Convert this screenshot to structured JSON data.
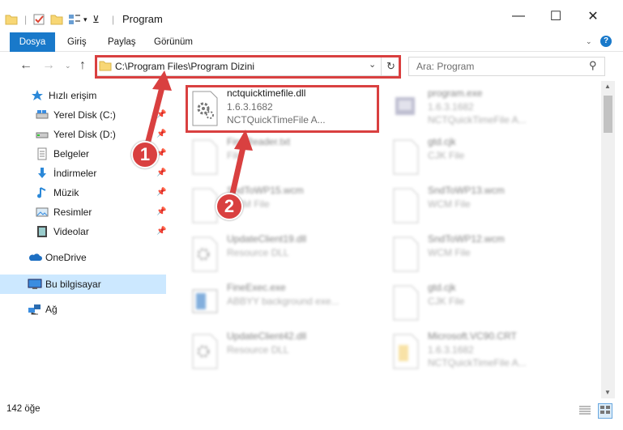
{
  "window": {
    "title": "Program",
    "minimize": "—",
    "maximize": "☐",
    "close": "✕"
  },
  "ribbon": {
    "tabs": [
      "Dosya",
      "Giriş",
      "Paylaş",
      "Görünüm"
    ],
    "help": "?"
  },
  "address": {
    "path": "C:\\Program Files\\Program Dizini"
  },
  "search": {
    "placeholder": "Ara: Program"
  },
  "sidebar": {
    "items": [
      {
        "label": "Hızlı erişim",
        "icon": "star-icon",
        "pinned": false
      },
      {
        "label": "Yerel Disk (C:)",
        "icon": "drive-icon",
        "pinned": true
      },
      {
        "label": "Yerel Disk (D:)",
        "icon": "drive-icon",
        "pinned": true
      },
      {
        "label": "Belgeler",
        "icon": "document-icon",
        "pinned": true
      },
      {
        "label": "İndirmeler",
        "icon": "download-icon",
        "pinned": true
      },
      {
        "label": "Müzik",
        "icon": "music-icon",
        "pinned": true
      },
      {
        "label": "Resimler",
        "icon": "pictures-icon",
        "pinned": true
      },
      {
        "label": "Videolar",
        "icon": "video-icon",
        "pinned": true
      },
      {
        "label": "OneDrive",
        "icon": "cloud-icon",
        "pinned": false
      },
      {
        "label": "Bu bilgisayar",
        "icon": "computer-icon",
        "pinned": false
      },
      {
        "label": "Ağ",
        "icon": "network-icon",
        "pinned": false
      }
    ]
  },
  "files": [
    {
      "name": "nctquicktimefile.dll",
      "line1": "1.6.3.1682",
      "line2": "NCTQuickTimeFile   A...",
      "icon": "dll-gear-icon",
      "highlighted": true
    },
    {
      "name": "program.exe",
      "line1": "1.6.3.1682",
      "line2": "NCTQuickTimeFile  A...",
      "icon": "exe-icon",
      "highlighted": false
    },
    {
      "name": "FineReader.txt",
      "line1": "File",
      "line2": "",
      "icon": "blank-file-icon",
      "highlighted": false
    },
    {
      "name": "gtd.cjk",
      "line1": "CJK File",
      "line2": "",
      "icon": "blank-file-icon",
      "highlighted": false
    },
    {
      "name": "SndToWP15.wcm",
      "line1": "WCM File",
      "line2": "",
      "icon": "blank-file-icon",
      "highlighted": false
    },
    {
      "name": "SndToWP13.wcm",
      "line1": "WCM File",
      "line2": "",
      "icon": "blank-file-icon",
      "highlighted": false
    },
    {
      "name": "UpdateClient19.dll",
      "line1": "Resource DLL",
      "line2": "",
      "icon": "dll-gear-icon",
      "highlighted": false
    },
    {
      "name": "SndToWP12.wcm",
      "line1": "WCM File",
      "line2": "",
      "icon": "blank-file-icon",
      "highlighted": false
    },
    {
      "name": "FineExec.exe",
      "line1": "ABBYY background exe...",
      "line2": "",
      "icon": "window-exe-icon",
      "highlighted": false
    },
    {
      "name": "gtd.cjk",
      "line1": "CJK File",
      "line2": "",
      "icon": "blank-file-icon",
      "highlighted": false
    },
    {
      "name": "UpdateClient42.dll",
      "line1": "Resource DLL",
      "line2": "",
      "icon": "dll-gear-icon",
      "highlighted": false
    },
    {
      "name": "Microsoft.VC90.CRT",
      "line1": "1.6.3.1682",
      "line2": "NCTQuickTimeFile  A...",
      "icon": "manifest-icon",
      "highlighted": false
    }
  ],
  "status": {
    "count": "142 öğe"
  },
  "callouts": [
    "1",
    "2"
  ],
  "colors": {
    "accent": "#1979ca",
    "highlight": "#d94040",
    "selection": "#cce8ff"
  }
}
